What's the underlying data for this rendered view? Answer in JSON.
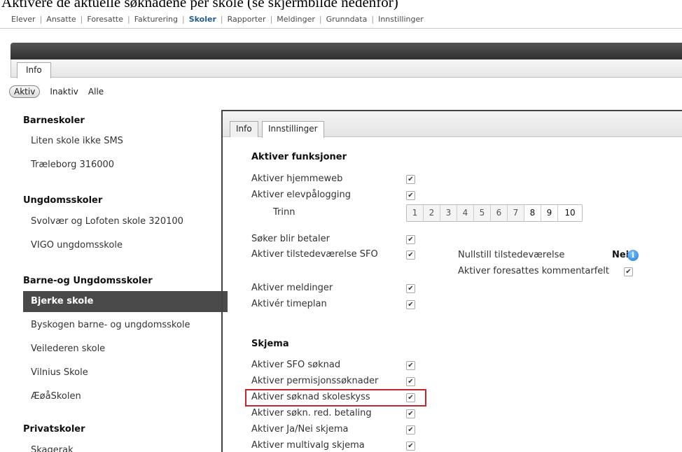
{
  "caption": "Aktivere de aktuelle søknadene per skole (se skjermbilde nedenfor)",
  "nav": [
    "Elever",
    "Ansatte",
    "Foresatte",
    "Fakturering",
    "Skoler",
    "Rapporter",
    "Meldinger",
    "Grunndata",
    "Innstillinger"
  ],
  "nav_active": "Skoler",
  "top_tab": "Info",
  "filters": {
    "active": "Aktiv",
    "inactive": "Inaktiv",
    "all": "Alle"
  },
  "groups": {
    "barneskoler": {
      "title": "Barneskoler",
      "schools": [
        "Liten skole ikke SMS",
        "Træleborg 316000"
      ]
    },
    "ungdomsskoler": {
      "title": "Ungdomsskoler",
      "schools": [
        "Svolvær og Lofoten skole 320100",
        "VIGO ungdomsskole"
      ]
    },
    "barne_ungdom": {
      "title": "Barne-og Ungdomsskoler",
      "schools": [
        "Bjerke skole",
        "Byskogen barne- og ungdomsskole",
        "Veilederen skole",
        "Vilnius Skole",
        "ÆøåSkolen"
      ]
    },
    "privat": {
      "title": "Privatskoler",
      "schools": [
        "Skagerak"
      ]
    }
  },
  "selected_school": "Bjerke skole",
  "panel_tabs": [
    "Info",
    "Innstillinger"
  ],
  "panel_tab_active": "Innstillinger",
  "functions": {
    "title": "Aktiver funksjoner",
    "hjemmeweb": "Aktiver hjemmeweb",
    "elevpalogging": "Aktiver elevpålogging",
    "trinn_label": "Trinn",
    "trinn": [
      "1",
      "2",
      "3",
      "4",
      "5",
      "6",
      "7",
      "8",
      "9",
      "10"
    ],
    "trinn_on": [
      "8",
      "9",
      "10"
    ],
    "betaler": "Søker blir betaler",
    "tilstede": "Aktiver tilstedeværelse SFO",
    "nullstill": "Nullstill tilstedeværelse",
    "nullstill_value": "Nei",
    "foresatt_kommentar": "Aktiver foresattes kommentarfelt",
    "meldinger": "Aktiver meldinger",
    "timeplan": "Aktivér timeplan"
  },
  "skjema": {
    "title": "Skjema",
    "sfo": "Aktiver SFO søknad",
    "permisjon": "Aktiver permisjonssøknader",
    "skoleskyss": "Aktiver søknad skoleskyss",
    "red_betaling": "Aktiver søkn. red. betaling",
    "janei": "Aktiver Ja/Nei skjema",
    "multivalg": "Aktiver multivalg skjema"
  },
  "check_glyph": "✔",
  "highlight_color": "#c0262d"
}
